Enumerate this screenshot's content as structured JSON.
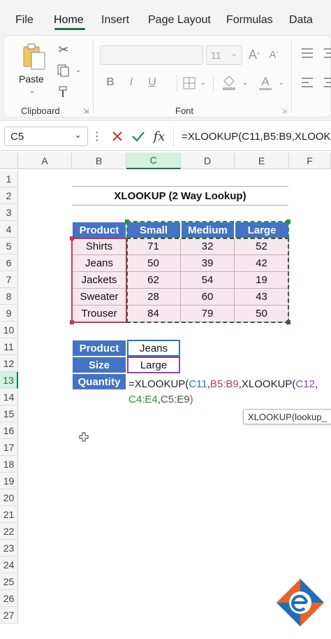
{
  "menu": {
    "tabs": [
      "File",
      "Home",
      "Insert",
      "Page Layout",
      "Formulas",
      "Data"
    ],
    "active": "Home"
  },
  "ribbon": {
    "paste_label": "Paste",
    "clipboard_label": "Clipboard",
    "font_label": "Font",
    "font_size": "11",
    "bold": "B",
    "italic": "I",
    "underline": "U",
    "grow_font": "A",
    "shrink_font": "A",
    "font_color": "A"
  },
  "formula_bar": {
    "name_box": "C5",
    "fx_label": "fx",
    "formula": "=XLOOKUP(C11,B5:B9,XLOOK"
  },
  "columns": [
    "A",
    "B",
    "C",
    "D",
    "E",
    "F"
  ],
  "selected_column": "C",
  "rows": [
    "1",
    "2",
    "3",
    "4",
    "5",
    "6",
    "7",
    "8",
    "9",
    "10",
    "11",
    "12",
    "13",
    "14",
    "15",
    "16",
    "17",
    "18",
    "19",
    "20",
    "21",
    "22",
    "23",
    "24",
    "25",
    "26",
    "27"
  ],
  "selected_row": "13",
  "sheet": {
    "title": "XLOOKUP (2 Way Lookup)",
    "table": {
      "header": [
        "Product",
        "Small",
        "Medium",
        "Large"
      ],
      "rows": [
        [
          "Shirts",
          "71",
          "32",
          "52"
        ],
        [
          "Jeans",
          "50",
          "39",
          "42"
        ],
        [
          "Jackets",
          "62",
          "54",
          "19"
        ],
        [
          "Sweater",
          "28",
          "60",
          "43"
        ],
        [
          "Trouser",
          "84",
          "79",
          "50"
        ]
      ]
    },
    "lookup": {
      "product_label": "Product",
      "product_value": "Jeans",
      "size_label": "Size",
      "size_value": "Large",
      "quantity_label": "Quantity"
    },
    "cell_formula": {
      "p1": "=XLOOKUP(",
      "p2": "C11",
      "p3": ",",
      "p4": "B5:B9",
      "p5": ",XLOOKUP(",
      "p6": "C12",
      "p7": ",",
      "p8": "C4:E4",
      "p9": ",",
      "p10": "C5:E9",
      "p11": ")"
    },
    "tooltip": "XLOOKUP(lookup_"
  },
  "colors": {
    "excel_green": "#1e7145",
    "header_blue": "#4472c4",
    "ref_blue": "#2e75b6",
    "ref_red": "#c0395a",
    "ref_green": "#2e8b3e",
    "ref_purple": "#8e44ad"
  }
}
